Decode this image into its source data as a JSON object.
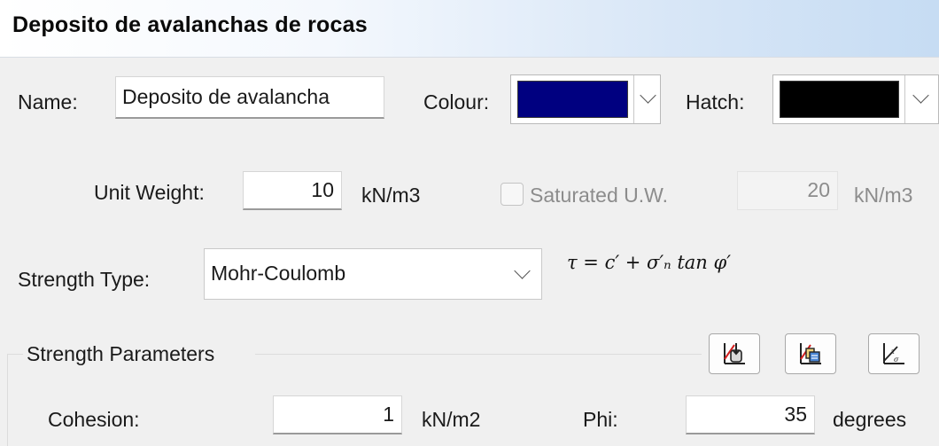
{
  "header": {
    "title": "Deposito de avalanchas de rocas"
  },
  "name": {
    "label": "Name:",
    "value": "Deposito de avalancha"
  },
  "colour": {
    "label": "Colour:",
    "swatch": "#000080"
  },
  "hatch": {
    "label": "Hatch:",
    "swatch": "#000000"
  },
  "unit_weight": {
    "label": "Unit Weight:",
    "value": "10",
    "unit": "kN/m3"
  },
  "saturated": {
    "label": "Saturated U.W.",
    "checked": false,
    "value": "20",
    "unit": "kN/m3"
  },
  "strength_type": {
    "label": "Strength Type:",
    "selected": "Mohr-Coulomb",
    "formula": "τ = c′ + σ′ₙ tan φ′"
  },
  "strength_parameters": {
    "title": "Strength Parameters",
    "buttons": [
      {
        "icon": "import-parameters-icon"
      },
      {
        "icon": "copy-parameters-icon"
      },
      {
        "icon": "strength-function-graph-icon"
      }
    ]
  },
  "cohesion": {
    "label": "Cohesion:",
    "value": "1",
    "unit": "kN/m2"
  },
  "phi": {
    "label": "Phi:",
    "value": "35",
    "unit": "degrees"
  }
}
